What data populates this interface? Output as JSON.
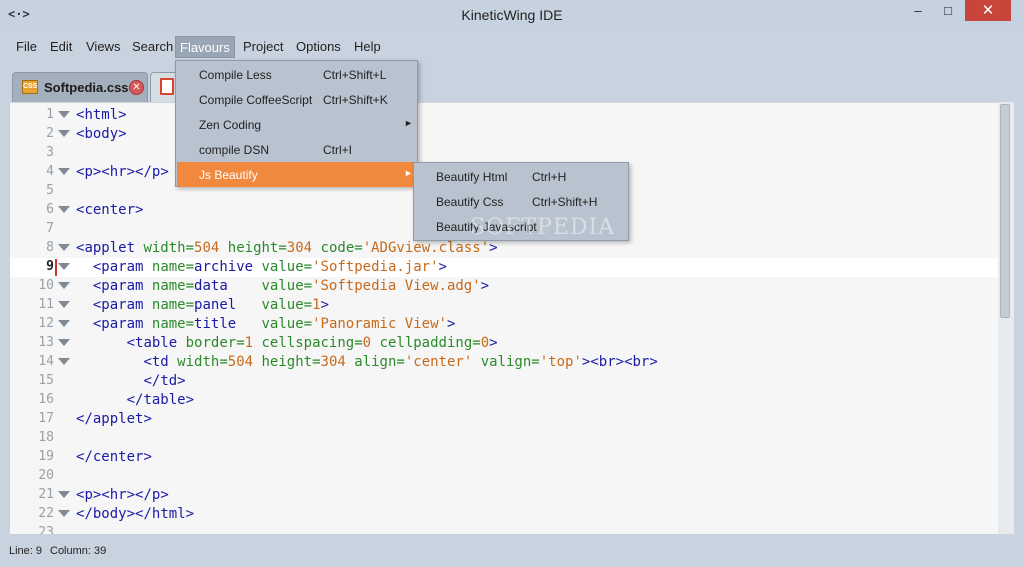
{
  "window": {
    "app_icon": "<·>",
    "title": "KineticWing IDE",
    "minimize": "–",
    "maximize": "□",
    "close": "✕"
  },
  "menubar": {
    "items": [
      "File",
      "Edit",
      "Views",
      "Search",
      "Flavours",
      "Project",
      "Options",
      "Help"
    ],
    "active": "Flavours"
  },
  "tabs": [
    {
      "label": "Softpedia.css",
      "icon": "css-file-icon",
      "icon_text": "CSS",
      "close": "✕"
    },
    {
      "label": "",
      "icon": "html-file-icon"
    }
  ],
  "editor": {
    "lines": [
      {
        "n": "1",
        "code": "<html>"
      },
      {
        "n": "2",
        "code": "<body>"
      },
      {
        "n": "3",
        "code": ""
      },
      {
        "n": "4",
        "code": "<p><hr></p>"
      },
      {
        "n": "5",
        "code": ""
      },
      {
        "n": "6",
        "code": "<center>"
      },
      {
        "n": "7",
        "code": ""
      },
      {
        "n": "8",
        "code": "<applet width=504 height=304 code='ADGview.class'>"
      },
      {
        "n": "9",
        "code": "  <param name=archive value='Softpedia.jar'>"
      },
      {
        "n": "10",
        "code": "  <param name=data    value='Softpedia View.adg'>"
      },
      {
        "n": "11",
        "code": "  <param name=panel   value=1>"
      },
      {
        "n": "12",
        "code": "  <param name=title   value='Panoramic View'>"
      },
      {
        "n": "13",
        "code": "      <table border=1 cellspacing=0 cellpadding=0>"
      },
      {
        "n": "14",
        "code": "        <td width=504 height=304 align='center' valign='top'><br><br>"
      },
      {
        "n": "15",
        "code": "        </td>"
      },
      {
        "n": "16",
        "code": "      </table>"
      },
      {
        "n": "17",
        "code": "</applet>"
      },
      {
        "n": "18",
        "code": ""
      },
      {
        "n": "19",
        "code": "</center>"
      },
      {
        "n": "20",
        "code": ""
      },
      {
        "n": "21",
        "code": "<p><hr></p>"
      },
      {
        "n": "22",
        "code": "</body></html>"
      },
      {
        "n": "23",
        "code": ""
      }
    ],
    "current_line": 9
  },
  "flavours_menu": {
    "items": [
      {
        "label": "Compile Less",
        "shortcut": "Ctrl+Shift+L",
        "submenu": false
      },
      {
        "label": "Compile CoffeeScript",
        "shortcut": "Ctrl+Shift+K",
        "submenu": false
      },
      {
        "label": "Zen Coding",
        "shortcut": "",
        "submenu": true
      },
      {
        "label": "compile DSN",
        "shortcut": "Ctrl+I",
        "submenu": false
      },
      {
        "label": "Js Beautify",
        "shortcut": "",
        "submenu": true
      }
    ],
    "highlighted": "Js Beautify",
    "arrow": "►"
  },
  "js_beautify_submenu": {
    "items": [
      {
        "label": "Beautify Html",
        "shortcut": "Ctrl+H"
      },
      {
        "label": "Beautify Css",
        "shortcut": "Ctrl+Shift+H"
      },
      {
        "label": "Beautify Javascript",
        "shortcut": ""
      }
    ]
  },
  "watermark": "SOFTPEDIA",
  "statusbar": {
    "line": "Line: 9",
    "column": "Column: 39"
  },
  "colors": {
    "chrome": "#c9d3df",
    "editor_bg": "#f6f6f6",
    "highlight_orange": "#f0883e",
    "tag_blue": "#1a1aa6",
    "attr_green": "#2a8a2a",
    "value_orange": "#c76a1a"
  }
}
